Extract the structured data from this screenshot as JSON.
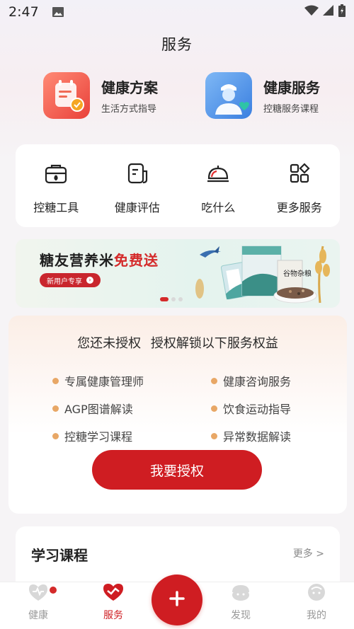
{
  "status_bar": {
    "time": "2:47"
  },
  "page_title": "服务",
  "features": [
    {
      "title": "健康方案",
      "subtitle": "生活方式指导",
      "icon": "health-plan-icon"
    },
    {
      "title": "健康服务",
      "subtitle": "控糖服务课程",
      "icon": "doctor-icon"
    }
  ],
  "tools": [
    {
      "label": "控糖工具",
      "icon": "toolbox-icon"
    },
    {
      "label": "健康评估",
      "icon": "assessment-icon"
    },
    {
      "label": "吃什么",
      "icon": "food-cloche-icon"
    },
    {
      "label": "更多服务",
      "icon": "grid-icon"
    }
  ],
  "banner": {
    "title_main": "糖友营养米",
    "title_highlight": "免费送",
    "tag": "新用户专享",
    "package_text": "谷物杂粮"
  },
  "auth": {
    "title": "您还未授权  授权解锁以下服务权益",
    "benefits": [
      "专属健康管理师",
      "健康咨询服务",
      "AGP图谱解读",
      "饮食运动指导",
      "控糖学习课程",
      "异常数据解读"
    ],
    "button": "我要授权"
  },
  "course": {
    "title": "学习课程",
    "more": "更多 >"
  },
  "tabbar": {
    "tabs": [
      {
        "label": "健康",
        "active": false
      },
      {
        "label": "服务",
        "active": true
      },
      {
        "label": "发现",
        "active": false
      },
      {
        "label": "我的",
        "active": false
      }
    ]
  },
  "colors": {
    "accent": "#cf1d22",
    "benefit_dot": "#e8a766"
  }
}
